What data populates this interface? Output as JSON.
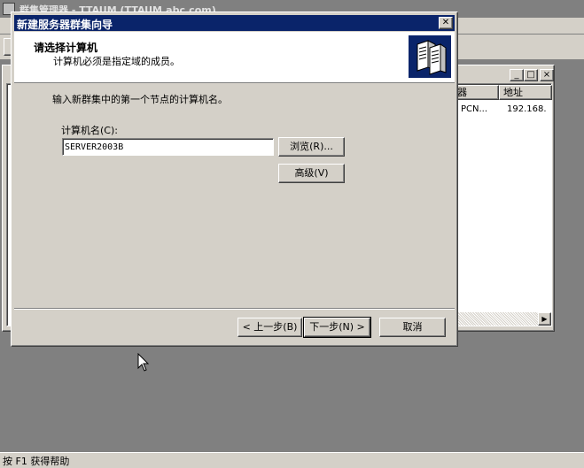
{
  "bg_window": {
    "title": "群集管理器 - TTAUM (TTAUM.abc.com)",
    "list_columns": [
      "器",
      "地址"
    ],
    "list_row": [
      "PCN...",
      "192.168."
    ]
  },
  "dialog": {
    "title": "新建服务器群集向导",
    "close_glyph": "✕",
    "header_title": "请选择计算机",
    "header_subtitle": "计算机必须是指定域的成员。",
    "instruction": "输入新群集中的第一个节点的计算机名。",
    "field_label": "计算机名(C):",
    "field_value": "SERVER2003B",
    "browse_label": "浏览(R)...",
    "advanced_label": "高级(V)",
    "back_label": "< 上一步(B)",
    "next_label": "下一步(N) >",
    "cancel_label": "取消"
  },
  "status_bar": {
    "text": "按 F1 获得帮助"
  },
  "colors": {
    "title_active": "#0a246a",
    "face": "#d4d0c8",
    "workspace": "#808080"
  }
}
